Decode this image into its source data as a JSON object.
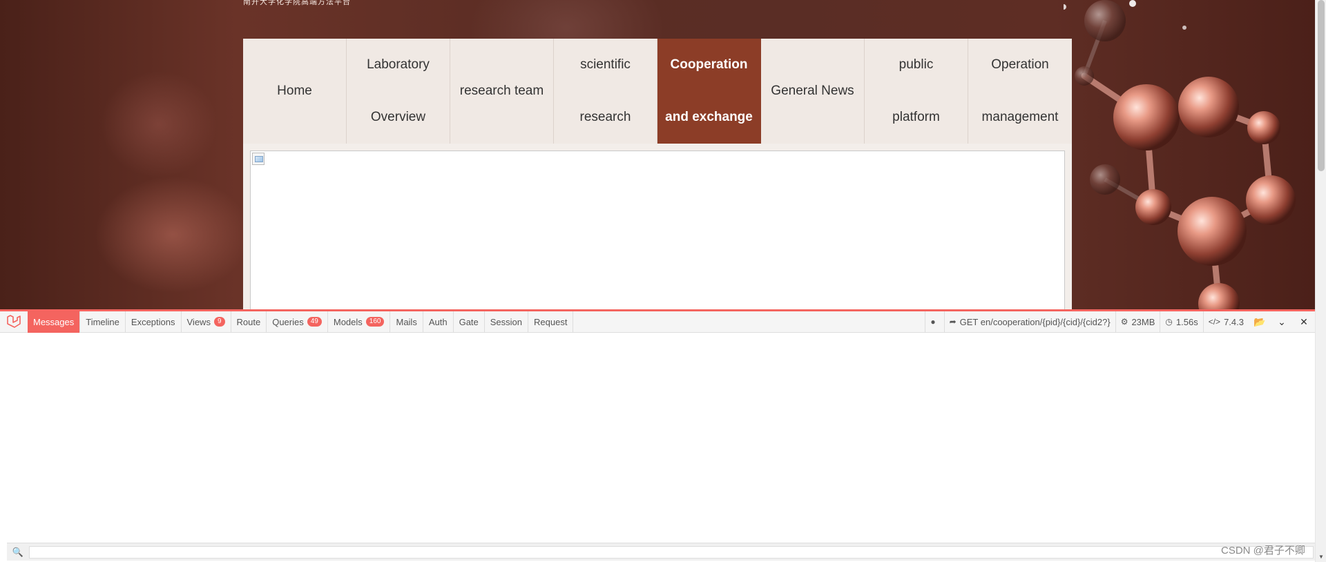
{
  "header": {
    "top_text": "南开大学化学院高端方法平台"
  },
  "nav": {
    "items": [
      {
        "line1": "Home",
        "line2": ""
      },
      {
        "line1": "Laboratory",
        "line2": "Overview"
      },
      {
        "line1": "research team",
        "line2": ""
      },
      {
        "line1": "scientific",
        "line2": "research"
      },
      {
        "line1": "Cooperation",
        "line2": "and exchange"
      },
      {
        "line1": "General News",
        "line2": ""
      },
      {
        "line1": "public",
        "line2": "platform"
      },
      {
        "line1": "Operation",
        "line2": "management"
      }
    ],
    "active_index": 4,
    "active_color": "#8c3d27"
  },
  "debugbar": {
    "accent_color": "#f4645f",
    "tabs": [
      {
        "label": "Messages",
        "badge": ""
      },
      {
        "label": "Timeline",
        "badge": ""
      },
      {
        "label": "Exceptions",
        "badge": ""
      },
      {
        "label": "Views",
        "badge": "9"
      },
      {
        "label": "Route",
        "badge": ""
      },
      {
        "label": "Queries",
        "badge": "49"
      },
      {
        "label": "Models",
        "badge": "160"
      },
      {
        "label": "Mails",
        "badge": ""
      },
      {
        "label": "Auth",
        "badge": ""
      },
      {
        "label": "Gate",
        "badge": ""
      },
      {
        "label": "Session",
        "badge": ""
      },
      {
        "label": "Request",
        "badge": ""
      }
    ],
    "active_tab": "Messages",
    "route": "GET en/cooperation/{pid}/{cid}/{cid2?}",
    "memory": "23MB",
    "time": "1.56s",
    "php_version": "7.4.3"
  },
  "search": {
    "placeholder": "",
    "value": ""
  },
  "watermark": "CSDN @君子不卿"
}
